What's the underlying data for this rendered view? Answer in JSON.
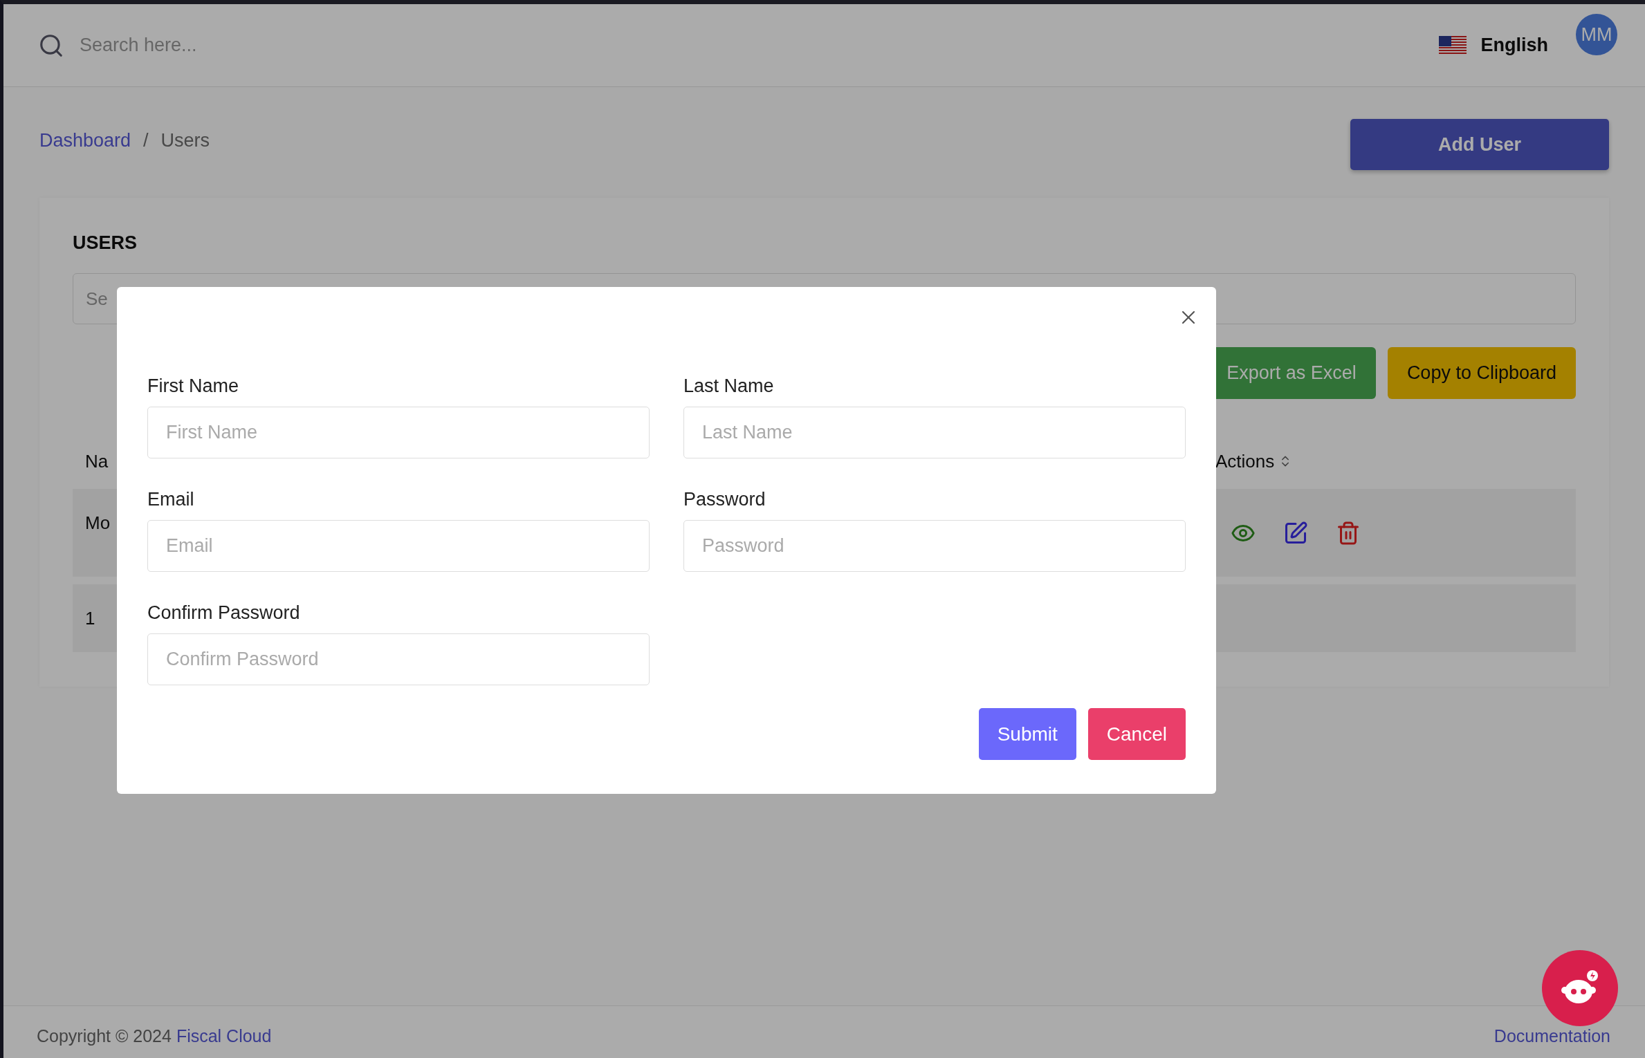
{
  "header": {
    "search": {
      "placeholder": "Search here..."
    },
    "language": "English",
    "avatar": "MM"
  },
  "breadcrumb": [
    {
      "label": "Dashboard",
      "kind": "link"
    },
    {
      "label": "Users",
      "kind": "current"
    }
  ],
  "breadcrumb_separator": "/",
  "add_button": "Add User",
  "card": {
    "title": "USERS",
    "search": {
      "placeholder": "Se"
    },
    "buttons": [
      {
        "label": "Export as Excel",
        "kind": "export"
      },
      {
        "label": "Copy to Clipboard",
        "kind": "copy"
      }
    ]
  },
  "table": {
    "columns": [
      {
        "label": "Na"
      },
      {
        "label": "Actions",
        "sortable": true
      }
    ],
    "rows": [
      {
        "cells": [
          "Mo"
        ],
        "actions": [
          {
            "kind": "view"
          },
          {
            "kind": "edit"
          },
          {
            "kind": "delete"
          }
        ]
      },
      {
        "cells": [
          "1"
        ]
      }
    ]
  },
  "modal": {
    "fields": [
      {
        "label": "First Name",
        "placeholder": "First Name"
      },
      {
        "label": "Last Name",
        "placeholder": "Last Name"
      },
      {
        "label": "Email",
        "placeholder": "Email"
      },
      {
        "label": "Password",
        "placeholder": "Password"
      },
      {
        "label": "Confirm Password",
        "placeholder": "Confirm Password"
      }
    ],
    "buttons": [
      {
        "label": "Submit",
        "kind": "primary"
      },
      {
        "label": "Cancel",
        "kind": "danger"
      }
    ]
  },
  "footer": {
    "copyright": "Copyright © 2024",
    "link": "Fiscal Cloud",
    "documentation": "Documentation"
  }
}
